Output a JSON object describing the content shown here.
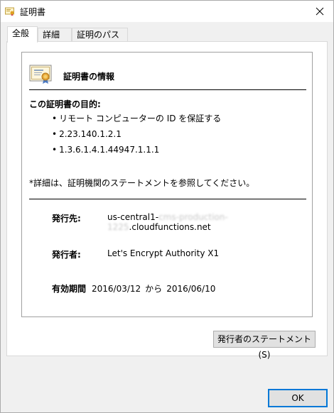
{
  "window": {
    "title": "証明書"
  },
  "tabs": [
    {
      "label": "全般",
      "active": true
    },
    {
      "label": "詳細",
      "active": false
    },
    {
      "label": "証明のパス",
      "active": false
    }
  ],
  "general": {
    "info_title": "証明書の情報",
    "purpose_title": "この証明書の目的:",
    "purposes": [
      "リモート コンピューターの ID を保証する",
      "2.23.140.1.2.1",
      "1.3.6.1.4.1.44947.1.1.1"
    ],
    "note": "*詳細は、証明機関のステートメントを参照してください。",
    "issued_to": {
      "label": "発行先:",
      "value_prefix": "us-central1-",
      "value_redacted": "cms-production-1225",
      "value_suffix": ".cloudfunctions.net"
    },
    "issued_by": {
      "label": "発行者:",
      "value": "Let's Encrypt Authority X1"
    },
    "validity": {
      "label": "有効期間",
      "from": "2016/03/12",
      "connector": "から",
      "to": "2016/06/10"
    }
  },
  "buttons": {
    "issuer_statement": "発行者のステートメント(S)",
    "ok": "OK"
  },
  "icons": {
    "title": "certificate-icon",
    "close": "close-icon",
    "cert_info": "certificate-icon"
  }
}
